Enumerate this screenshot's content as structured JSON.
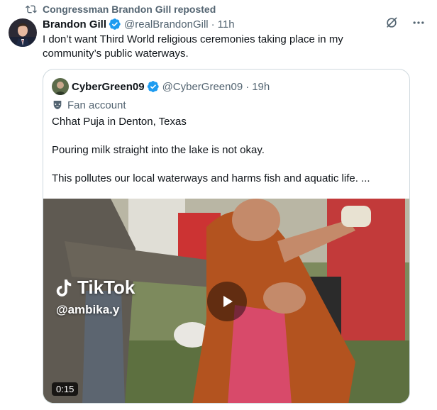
{
  "repost": {
    "text": "Congressman Brandon Gill reposted",
    "icon": "repost-icon"
  },
  "tweet": {
    "author_name": "Brandon Gill",
    "handle": "@realBrandonGill",
    "separator": "·",
    "time": "11h",
    "text": "I don’t want Third World religious ceremonies taking place in my community’s public waterways."
  },
  "quote": {
    "author_name": "CyberGreen09",
    "handle": "@CyberGreen09",
    "separator": "·",
    "time": "19h",
    "label": "Fan account",
    "line1": "Chhat Puja in Denton, Texas",
    "line2": "Pouring milk straight into the lake is not okay.",
    "line3": "This pollutes our local waterways and harms fish and aquatic life. ..."
  },
  "media": {
    "watermark": "TikTok",
    "watermark_user": "@ambika.y",
    "duration": "0:15"
  },
  "colors": {
    "accent": "#1d9bf0",
    "secondary_text": "#536471",
    "border": "#cfd9de"
  }
}
